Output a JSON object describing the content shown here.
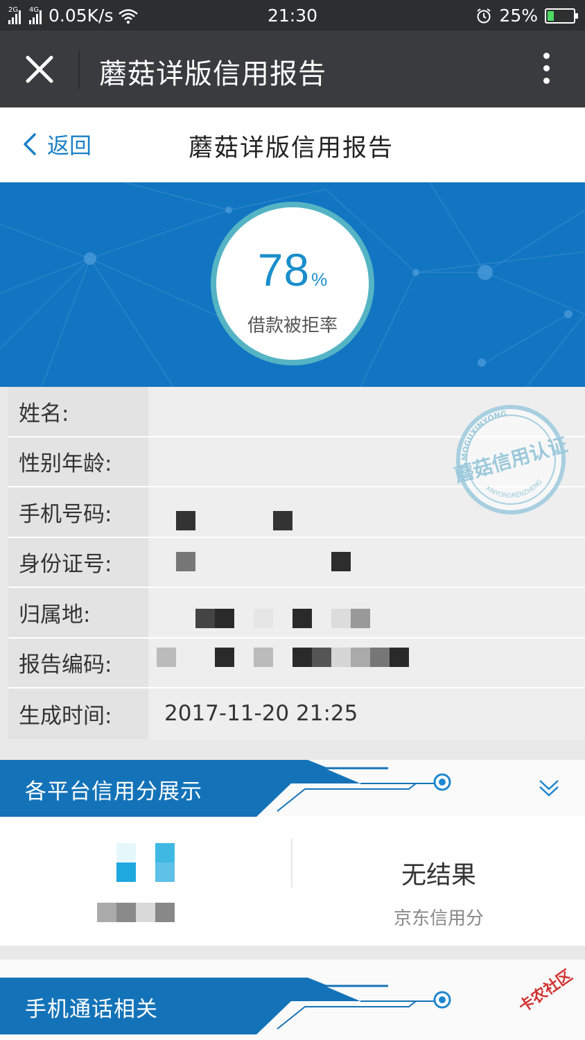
{
  "status_bar": {
    "net1": "2G",
    "net2": "4G",
    "speed": "0.05K/s",
    "time": "21:30",
    "battery": "25%",
    "battery_level": 0.25
  },
  "app_bar": {
    "title": "蘑菇详版信用报告"
  },
  "nav": {
    "back_label": "返回",
    "title": "蘑菇详版信用报告"
  },
  "hero": {
    "rate_value": "78",
    "rate_unit": "%",
    "rate_label": "借款被拒率"
  },
  "info": {
    "name_label": "姓名:",
    "gender_age_label": "性别年龄:",
    "phone_label": "手机号码:",
    "id_label": "身份证号:",
    "location_label": "归属地:",
    "report_no_label": "报告编码:",
    "generated_label": "生成时间:",
    "generated_value": "2017-11-20 21:25"
  },
  "stamp": {
    "text_top": "MOGUXINYONG",
    "text_main": "蘑菇信用认证",
    "text_bottom": "XINYONGRENZHENG"
  },
  "section_scores": {
    "title": "各平台信用分展示",
    "result": "无结果",
    "source": "京东信用分"
  },
  "section_phone": {
    "title": "手机通话相关"
  },
  "watermark": "卡农社区",
  "colors": {
    "brand_blue": "#1275c2",
    "ring_teal": "#55b4c4",
    "link_blue": "#1a80c6"
  }
}
